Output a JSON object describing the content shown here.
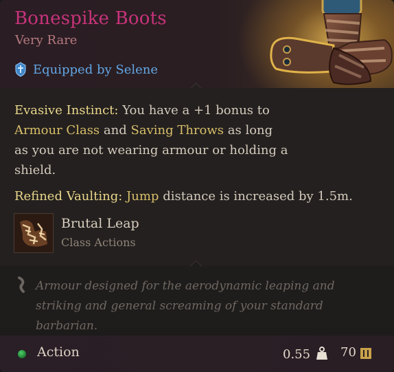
{
  "item": {
    "name": "Bonespike Boots",
    "rarity": "Very Rare",
    "equipped_by": "Equipped by Selene"
  },
  "passives": [
    {
      "name": "Evasive Instinct:",
      "text_parts": [
        "You have a +1 bonus to",
        "Armour Class",
        "and",
        "Saving Throws",
        "as long as you are not wearing armour or holding a shield."
      ]
    },
    {
      "name": "Refined Vaulting:",
      "text_parts": [
        "Jump",
        "distance is increased by 1.5m."
      ]
    }
  ],
  "granted_action": {
    "name": "Brutal Leap",
    "category": "Class Actions"
  },
  "flavor_text": "Armour designed for the aerodynamic leaping and striking and general screaming of your standard barbarian.",
  "footer": {
    "action_label": "Action",
    "weight": "0.55",
    "price": "70"
  },
  "colors": {
    "rarity_title": "#c8337a",
    "keyword": "#e9d78b",
    "equipped": "#62a7e6",
    "action_dot": "#3bbf5a"
  },
  "icons": [
    "helmet-icon",
    "boots-item-icon",
    "brutal-leap-icon",
    "quill-icon",
    "weight-icon",
    "gold-coin-icon"
  ]
}
